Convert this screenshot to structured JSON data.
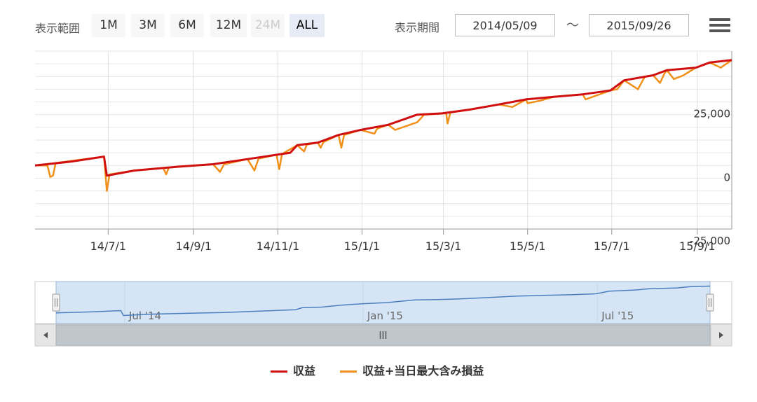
{
  "toolbar": {
    "range_label": "表示範囲",
    "range_buttons": [
      {
        "label": "1M",
        "state": "normal"
      },
      {
        "label": "3M",
        "state": "normal"
      },
      {
        "label": "6M",
        "state": "normal"
      },
      {
        "label": "12M",
        "state": "normal"
      },
      {
        "label": "24M",
        "state": "disabled"
      },
      {
        "label": "ALL",
        "state": "selected"
      }
    ],
    "period_label": "表示期間",
    "from_date": "2014/05/09",
    "to_date": "2015/09/26",
    "separator": "～",
    "menu_icon": "hamburger-menu-icon"
  },
  "chart_data": {
    "type": "line",
    "x_start": "2014-05-09",
    "x_end": "2015-09-26",
    "x_ticks": [
      "14/7/1",
      "14/9/1",
      "14/11/1",
      "15/1/1",
      "15/3/1",
      "15/5/1",
      "15/7/1",
      "15/9/1"
    ],
    "x_tick_dates": [
      "2014-07-01",
      "2014-09-01",
      "2014-11-01",
      "2015-01-01",
      "2015-03-01",
      "2015-05-01",
      "2015-07-01",
      "2015-09-01"
    ],
    "y_ticks": [
      "-25,000",
      "0",
      "25,000"
    ],
    "y_tick_values": [
      -25000,
      0,
      25000
    ],
    "ylim": [
      -25000,
      45000
    ],
    "y_axis_side": "right",
    "grid": true,
    "legend_position": "bottom-center",
    "colors": {
      "profit": "#d01010",
      "floating": "#f0901a",
      "navigator_line": "#4a7fbf",
      "navigator_fill": "#d6e5f6"
    },
    "series": [
      {
        "name": "収益",
        "color": "#d01010",
        "points": [
          [
            "2014-05-09",
            0
          ],
          [
            "2014-06-04",
            1500
          ],
          [
            "2014-06-28",
            3500
          ],
          [
            "2014-06-30",
            -4000
          ],
          [
            "2014-07-20",
            -2000
          ],
          [
            "2014-08-20",
            -500
          ],
          [
            "2014-09-15",
            500
          ],
          [
            "2014-10-10",
            2500
          ],
          [
            "2014-10-31",
            4200
          ],
          [
            "2014-11-10",
            5000
          ],
          [
            "2014-11-15",
            8000
          ],
          [
            "2014-11-30",
            9000
          ],
          [
            "2014-12-15",
            12000
          ],
          [
            "2014-12-31",
            14000
          ],
          [
            "2015-01-20",
            16000
          ],
          [
            "2015-02-10",
            20000
          ],
          [
            "2015-02-28",
            20500
          ],
          [
            "2015-03-20",
            22000
          ],
          [
            "2015-04-10",
            24000
          ],
          [
            "2015-04-30",
            26000
          ],
          [
            "2015-05-20",
            27000
          ],
          [
            "2015-06-10",
            28000
          ],
          [
            "2015-06-30",
            29500
          ],
          [
            "2015-07-10",
            33500
          ],
          [
            "2015-07-31",
            35500
          ],
          [
            "2015-08-10",
            37500
          ],
          [
            "2015-08-31",
            38500
          ],
          [
            "2015-09-10",
            40500
          ],
          [
            "2015-09-26",
            41500
          ]
        ]
      },
      {
        "name": "収益+当日最大含み損益",
        "color": "#f0901a",
        "points": [
          [
            "2014-05-09",
            0
          ],
          [
            "2014-05-18",
            0
          ],
          [
            "2014-05-20",
            -4500
          ],
          [
            "2014-05-22",
            -4000
          ],
          [
            "2014-05-24",
            1000
          ],
          [
            "2014-06-28",
            3500
          ],
          [
            "2014-06-30",
            -10000
          ],
          [
            "2014-07-02",
            -3500
          ],
          [
            "2014-07-20",
            -2000
          ],
          [
            "2014-08-10",
            -1000
          ],
          [
            "2014-08-12",
            -3500
          ],
          [
            "2014-08-14",
            -800
          ],
          [
            "2014-09-15",
            500
          ],
          [
            "2014-09-20",
            -2500
          ],
          [
            "2014-09-23",
            500
          ],
          [
            "2014-10-10",
            2500
          ],
          [
            "2014-10-15",
            -2000
          ],
          [
            "2014-10-18",
            2700
          ],
          [
            "2014-10-31",
            4200
          ],
          [
            "2014-11-02",
            -1500
          ],
          [
            "2014-11-04",
            4500
          ],
          [
            "2014-11-15",
            8000
          ],
          [
            "2014-11-20",
            5500
          ],
          [
            "2014-11-22",
            8200
          ],
          [
            "2014-11-30",
            9000
          ],
          [
            "2014-12-02",
            7000
          ],
          [
            "2014-12-04",
            9200
          ],
          [
            "2014-12-15",
            12000
          ],
          [
            "2014-12-17",
            7000
          ],
          [
            "2014-12-19",
            12000
          ],
          [
            "2014-12-31",
            14000
          ],
          [
            "2015-01-10",
            12500
          ],
          [
            "2015-01-12",
            14500
          ],
          [
            "2015-01-20",
            16000
          ],
          [
            "2015-01-25",
            14000
          ],
          [
            "2015-02-10",
            17000
          ],
          [
            "2015-02-15",
            20000
          ],
          [
            "2015-03-03",
            20500
          ],
          [
            "2015-03-04",
            16500
          ],
          [
            "2015-03-06",
            20800
          ],
          [
            "2015-03-20",
            22000
          ],
          [
            "2015-04-10",
            24000
          ],
          [
            "2015-04-20",
            23000
          ],
          [
            "2015-04-30",
            26000
          ],
          [
            "2015-05-01",
            24500
          ],
          [
            "2015-05-10",
            25500
          ],
          [
            "2015-05-20",
            27000
          ],
          [
            "2015-06-10",
            28000
          ],
          [
            "2015-06-12",
            26000
          ],
          [
            "2015-06-30",
            29500
          ],
          [
            "2015-07-05",
            30000
          ],
          [
            "2015-07-10",
            33500
          ],
          [
            "2015-07-20",
            30000
          ],
          [
            "2015-07-25",
            35000
          ],
          [
            "2015-07-31",
            35500
          ],
          [
            "2015-08-05",
            32500
          ],
          [
            "2015-08-08",
            36000
          ],
          [
            "2015-08-10",
            37500
          ],
          [
            "2015-08-15",
            34000
          ],
          [
            "2015-08-22",
            35500
          ],
          [
            "2015-08-31",
            38500
          ],
          [
            "2015-09-10",
            40500
          ],
          [
            "2015-09-18",
            38500
          ],
          [
            "2015-09-26",
            41500
          ]
        ]
      }
    ],
    "navigator_ticks": [
      "Jul '14",
      "Jan '15",
      "Jul '15"
    ],
    "navigator_tick_dates": [
      "2014-07-01",
      "2015-01-01",
      "2015-07-01"
    ],
    "navigator_window": [
      "2014-05-09",
      "2015-09-26"
    ],
    "scrollbar_icon": "scrollbar-grip-icon"
  },
  "legend": [
    {
      "label": "収益",
      "color": "#d01010"
    },
    {
      "label": "収益+当日最大含み損益",
      "color": "#f0901a"
    }
  ]
}
